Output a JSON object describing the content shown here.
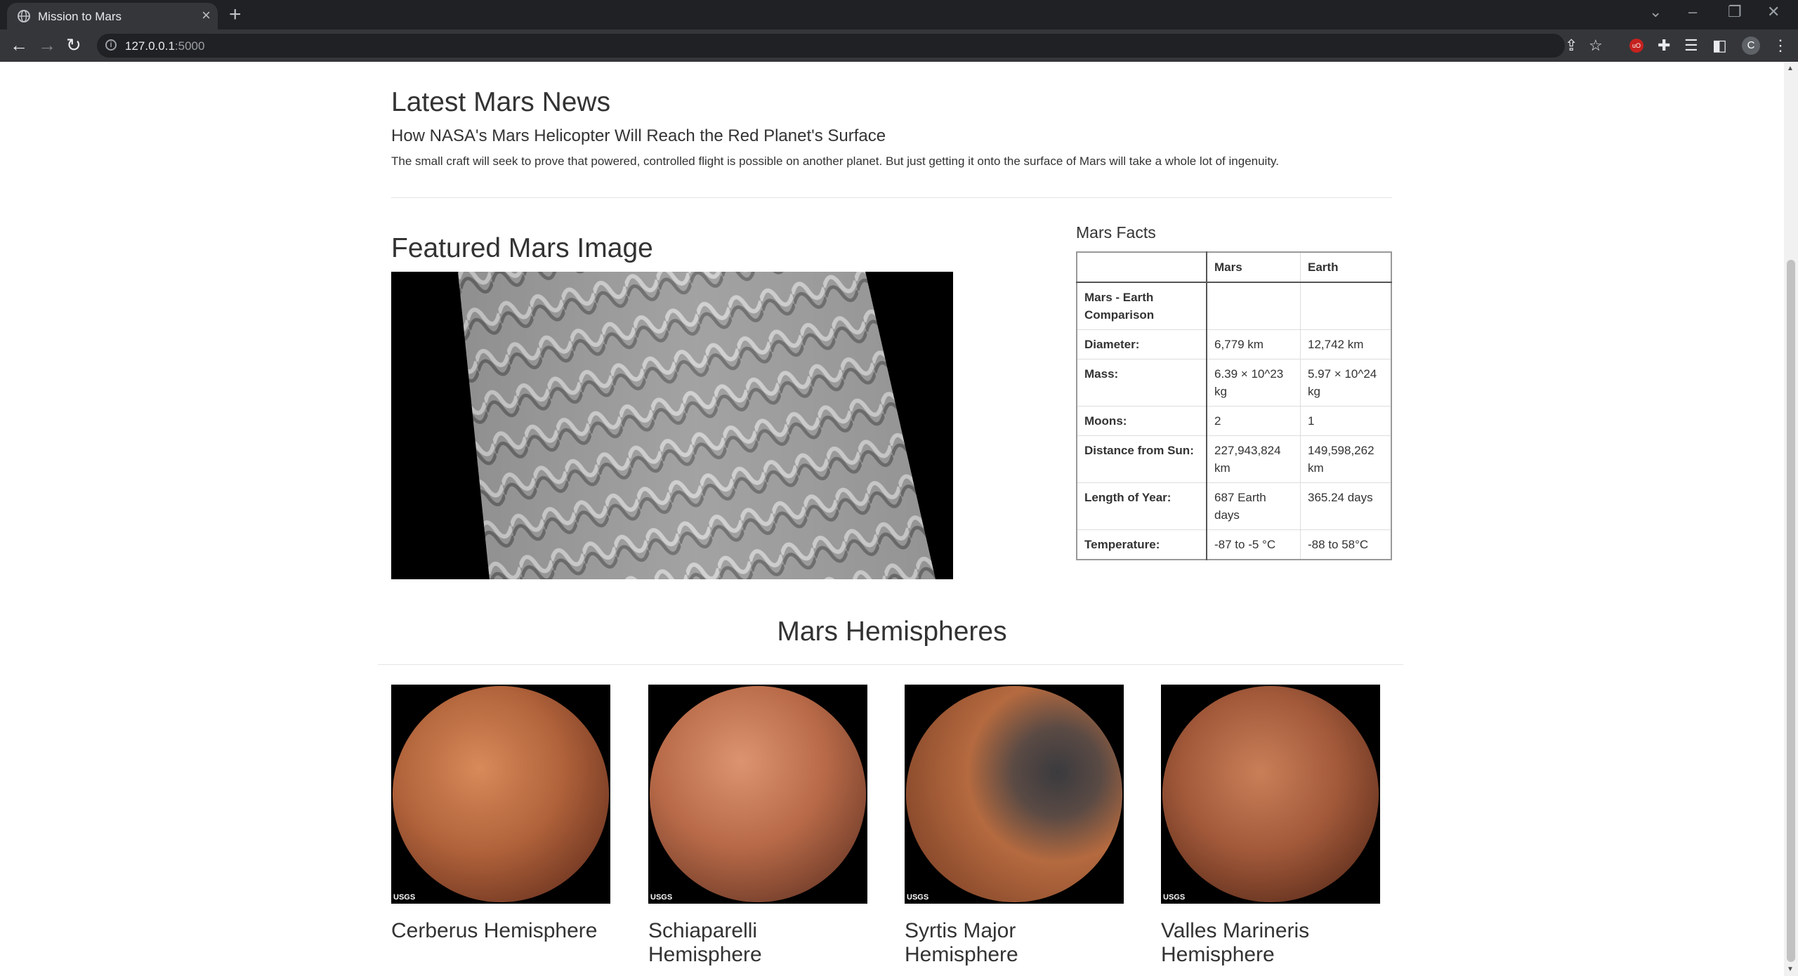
{
  "browser": {
    "tab_title": "Mission to Mars",
    "url_host": "127.0.0.1",
    "url_port": ":5000",
    "profile_initial": "C"
  },
  "news": {
    "heading": "Latest Mars News",
    "title": "How NASA's Mars Helicopter Will Reach the Red Planet's Surface",
    "teaser": "The small craft will seek to prove that powered, controlled flight is possible on another planet. But just getting it onto the surface of Mars will take a whole lot of ingenuity."
  },
  "featured": {
    "heading": "Featured Mars Image"
  },
  "facts": {
    "heading": "Mars Facts",
    "columns": [
      "",
      "Mars",
      "Earth"
    ],
    "rows": [
      {
        "label": "Mars - Earth Comparison",
        "mars": "",
        "earth": ""
      },
      {
        "label": "Diameter:",
        "mars": "6,779 km",
        "earth": "12,742 km"
      },
      {
        "label": "Mass:",
        "mars": "6.39 × 10^23 kg",
        "earth": "5.97 × 10^24 kg"
      },
      {
        "label": "Moons:",
        "mars": "2",
        "earth": "1"
      },
      {
        "label": "Distance from Sun:",
        "mars": "227,943,824 km",
        "earth": "149,598,262 km"
      },
      {
        "label": "Length of Year:",
        "mars": "687 Earth days",
        "earth": "365.24 days"
      },
      {
        "label": "Temperature:",
        "mars": "-87 to -5 °C",
        "earth": "-88 to 58°C"
      }
    ]
  },
  "hemispheres": {
    "heading": "Mars Hemispheres",
    "items": [
      {
        "name": "Cerberus Hemisphere",
        "color": "#b0623a"
      },
      {
        "name": "Schiaparelli Hemisphere",
        "color": "#b86a48"
      },
      {
        "name": "Syrtis Major Hemisphere",
        "color": "#b56a3f"
      },
      {
        "name": "Valles Marineris Hemisphere",
        "color": "#a2593a"
      }
    ],
    "logo_text": "USGS"
  }
}
